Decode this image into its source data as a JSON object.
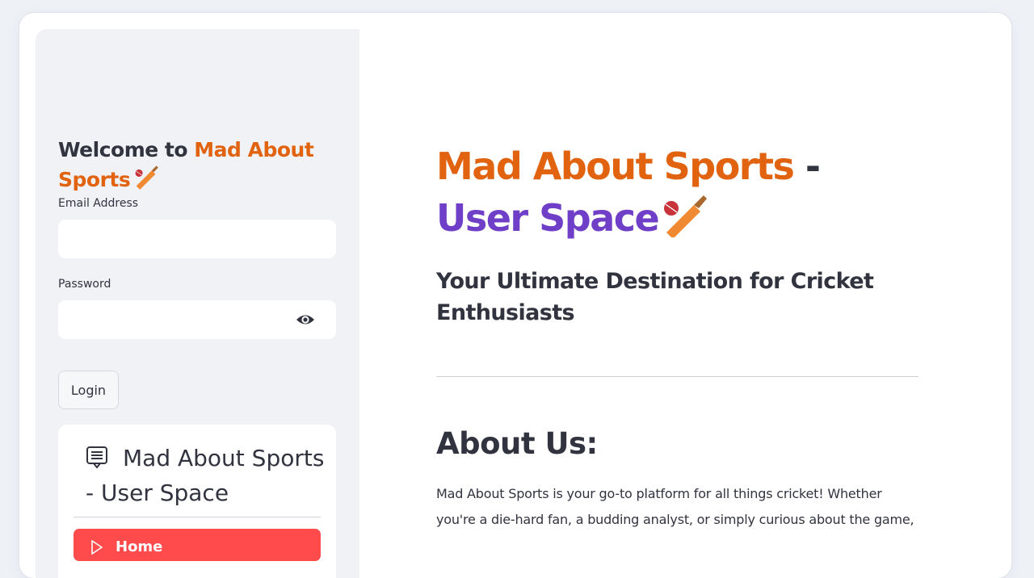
{
  "sidebar": {
    "welcome_prefix": "Welcome to ",
    "welcome_brand": "Mad About Sports",
    "email_label": "Email Address",
    "email_value": "",
    "password_label": "Password",
    "password_value": "",
    "login_label": "Login",
    "nav": {
      "title": "Mad About Sports - User Space",
      "items": [
        {
          "label": "Home",
          "active": true
        }
      ]
    }
  },
  "main": {
    "title_part1": "Mad About Sports",
    "title_dash": " - ",
    "title_part2": "User Space",
    "subtitle": "Your Ultimate Destination for Cricket Enthusiasts",
    "about_heading": "About Us:",
    "about_text": "Mad About Sports is your go-to platform for all things cricket! Whether you're a die-hard fan, a budding analyst, or simply curious about the game,"
  },
  "colors": {
    "accent_orange": "#e16310",
    "accent_purple": "#6f3fc8",
    "active_nav": "#ff4b4b"
  },
  "icons": [
    "cricket-bat-ball-icon",
    "eye-icon",
    "document-list-icon",
    "home-icon"
  ]
}
